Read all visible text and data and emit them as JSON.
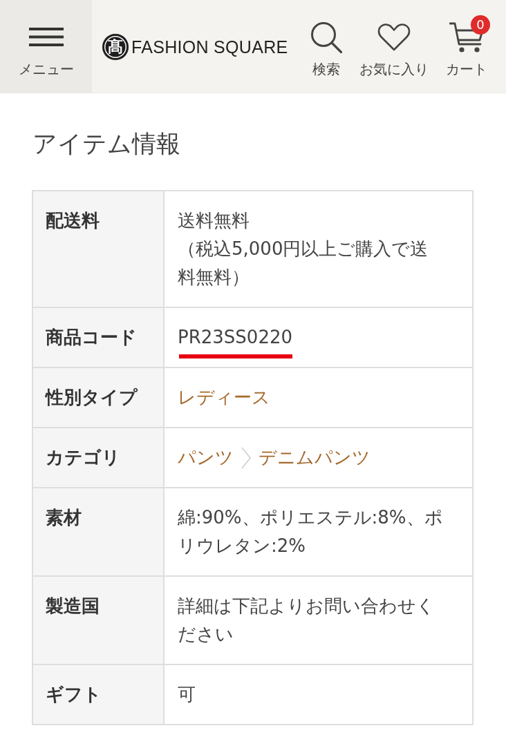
{
  "header": {
    "menu_button": {
      "label": "メニュー"
    },
    "logo": {
      "mark": "髙",
      "text": "FASHION SQUARE"
    },
    "actions": [
      {
        "kind": "search",
        "label": "検索"
      },
      {
        "kind": "favorites",
        "label": "お気に入り"
      },
      {
        "kind": "cart",
        "label": "カート",
        "badge": "0"
      }
    ]
  },
  "section_title": "アイテム情報",
  "table": {
    "rows": [
      {
        "label": "配送料",
        "kind": "text",
        "lines": [
          "送料無料",
          "（税込5,000円以上ご購入で送料無料）"
        ],
        "underlined": false
      },
      {
        "label": "商品コード",
        "kind": "text",
        "lines": [
          "PR23SS0220"
        ],
        "underlined": true
      },
      {
        "label": "性別タイプ",
        "kind": "links",
        "links": [
          "レディース"
        ],
        "underlined": false
      },
      {
        "label": "カテゴリ",
        "kind": "links",
        "links": [
          "パンツ",
          "デニムパンツ"
        ],
        "underlined": false
      },
      {
        "label": "素材",
        "kind": "text",
        "lines": [
          "綿:90%、ポリエステル:8%、ポリウレタン:2%"
        ],
        "underlined": false
      },
      {
        "label": "製造国",
        "kind": "text",
        "lines": [
          "詳細は下記よりお問い合わせください"
        ],
        "underlined": false
      },
      {
        "label": "ギフト",
        "kind": "text",
        "lines": [
          "可"
        ],
        "underlined": false
      }
    ]
  }
}
